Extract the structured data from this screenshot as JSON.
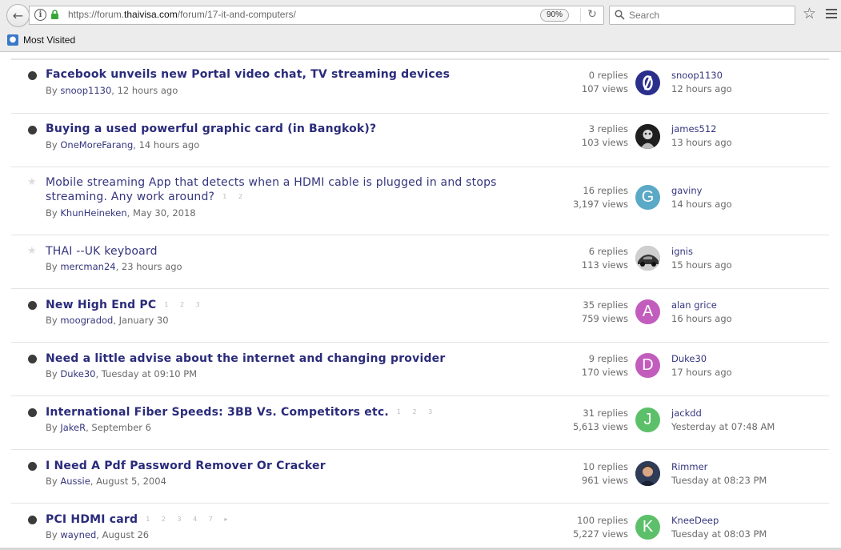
{
  "browser": {
    "url_prefix": "https://forum.",
    "url_host": "thaivisa.com",
    "url_path": "/forum/17-it-and-computers/",
    "zoom": "90%",
    "search_placeholder": "Search",
    "bookmark_label": "Most Visited"
  },
  "topics": [
    {
      "title": "Facebook unveils new Portal video chat, TV streaming devices",
      "title_cont": "",
      "bold": true,
      "pinned": false,
      "pages": "",
      "by": "By ",
      "author": "snoop1130",
      "date": ", 12 hours ago",
      "replies": "0 replies",
      "views": "107 views",
      "avatar_letter": "",
      "avatar_color": "#2b2f8c",
      "last_user": "snoop1130",
      "last_time": "12 hours ago"
    },
    {
      "title": "Buying a used powerful graphic card (in Bangkok)?",
      "title_cont": "",
      "bold": true,
      "pinned": false,
      "pages": "",
      "by": "By ",
      "author": "OneMoreFarang",
      "date": ", 14 hours ago",
      "replies": "3 replies",
      "views": "103 views",
      "avatar_letter": "",
      "avatar_color": "#222222",
      "last_user": "james512",
      "last_time": "13 hours ago"
    },
    {
      "title": "Mobile streaming App that detects when a HDMI cable is plugged in and stops",
      "title_cont": "streaming. Any work around?",
      "bold": false,
      "pinned": true,
      "pages": "1 2",
      "by": "By ",
      "author": "KhunHeineken",
      "date": ", May 30, 2018",
      "replies": "16 replies",
      "views": "3,197 views",
      "avatar_letter": "G",
      "avatar_color": "#5aa9c6",
      "last_user": "gaviny",
      "last_time": "14 hours ago"
    },
    {
      "title": "THAI --UK keyboard",
      "title_cont": "",
      "bold": false,
      "pinned": true,
      "pages": "",
      "by": "By ",
      "author": "mercman24",
      "date": ", 23 hours ago",
      "replies": "6 replies",
      "views": "113 views",
      "avatar_letter": "",
      "avatar_color": "#7a7a7a",
      "last_user": "ignis",
      "last_time": "15 hours ago"
    },
    {
      "title": "New High End PC",
      "title_cont": "",
      "bold": true,
      "pinned": false,
      "pages": "1 2 3",
      "by": "By ",
      "author": "moogradod",
      "date": ", January 30",
      "replies": "35 replies",
      "views": "759 views",
      "avatar_letter": "A",
      "avatar_color": "#c25dbd",
      "last_user": "alan grice",
      "last_time": "16 hours ago"
    },
    {
      "title": "Need a little advise about the internet and changing provider",
      "title_cont": "",
      "bold": true,
      "pinned": false,
      "pages": "",
      "by": "By ",
      "author": "Duke30",
      "date": ", Tuesday at 09:10 PM",
      "replies": "9 replies",
      "views": "170 views",
      "avatar_letter": "D",
      "avatar_color": "#c25dbd",
      "last_user": "Duke30",
      "last_time": "17 hours ago"
    },
    {
      "title": "International Fiber Speeds: 3BB Vs. Competitors etc.",
      "title_cont": "",
      "bold": true,
      "pinned": false,
      "pages": "1 2 3",
      "by": "By ",
      "author": "JakeR",
      "date": ", September 6",
      "replies": "31 replies",
      "views": "5,613 views",
      "avatar_letter": "J",
      "avatar_color": "#5cc06a",
      "last_user": "jackdd",
      "last_time": "Yesterday at 07:48 AM"
    },
    {
      "title": "I Need A Pdf Password Remover Or Cracker",
      "title_cont": "",
      "bold": true,
      "pinned": false,
      "pages": "",
      "by": "By ",
      "author": "Aussie",
      "date": ", August 5, 2004",
      "replies": "10 replies",
      "views": "961 views",
      "avatar_letter": "",
      "avatar_color": "#3a4660",
      "last_user": "Rimmer",
      "last_time": "Tuesday at 08:23 PM"
    },
    {
      "title": "PCI HDMI card",
      "title_cont": "",
      "bold": true,
      "pinned": false,
      "pages": "1 2 3 4 7 ▸",
      "by": "By ",
      "author": "wayned",
      "date": ", August 26",
      "replies": "100 replies",
      "views": "5,227 views",
      "avatar_letter": "K",
      "avatar_color": "#5cc06a",
      "last_user": "KneeDeep",
      "last_time": "Tuesday at 08:03 PM"
    }
  ]
}
